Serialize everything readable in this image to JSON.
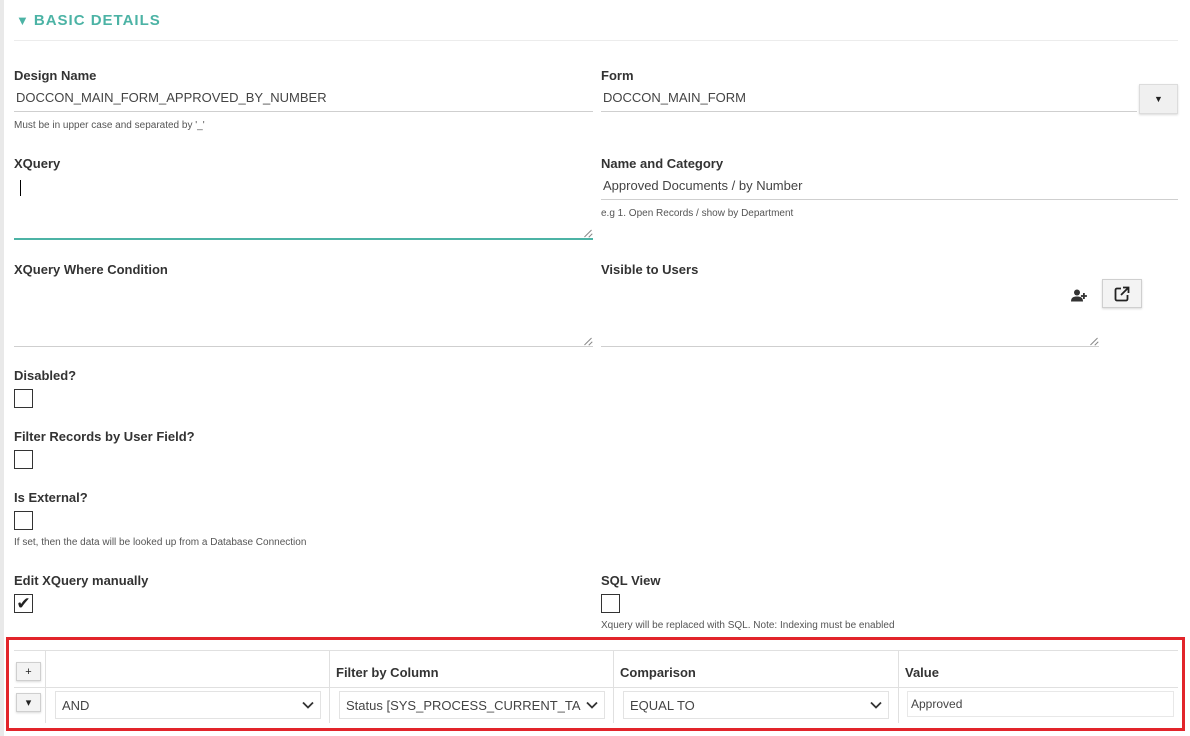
{
  "section": {
    "title": "BASIC DETAILS",
    "expanded_icon": "triangle-down-icon"
  },
  "fields": {
    "design_name": {
      "label": "Design Name",
      "value": "DOCCON_MAIN_FORM_APPROVED_BY_NUMBER",
      "hint": "Must be in upper case and separated by '_'"
    },
    "form": {
      "label": "Form",
      "value": "DOCCON_MAIN_FORM",
      "dropdown_icon": "caret-down-icon"
    },
    "xquery": {
      "label": "XQuery",
      "value": ""
    },
    "name_category": {
      "label": "Name and Category",
      "value": "Approved Documents / by Number",
      "hint": "e.g 1. Open Records / show by Department"
    },
    "xquery_where": {
      "label": "XQuery Where Condition",
      "value": ""
    },
    "visible_users": {
      "label": "Visible to Users",
      "value": ""
    },
    "disabled": {
      "label": "Disabled?",
      "checked": false
    },
    "filter_user": {
      "label": "Filter Records by User Field?",
      "checked": false
    },
    "is_external": {
      "label": "Is External?",
      "checked": false,
      "hint": "If set, then the data will be looked up from a Database Connection"
    },
    "edit_manually": {
      "label": "Edit XQuery manually",
      "checked": true,
      "check_glyph": "✔"
    },
    "sql_view": {
      "label": "SQL View",
      "checked": false,
      "hint": "Xquery will be replaced with SQL. Note: Indexing must be enabled"
    }
  },
  "filter_table": {
    "highlight_color": "#e2242a",
    "add_label": "+",
    "row_menu_glyph": "▾",
    "headers": {
      "filter_by_column": "Filter by Column",
      "comparison": "Comparison",
      "value": "Value"
    },
    "rows": [
      {
        "logic": "AND",
        "column": "Status [SYS_PROCESS_CURRENT_TA",
        "comparison": "EQUAL TO",
        "value": "Approved"
      }
    ]
  },
  "colors": {
    "accent": "#4cb3a5",
    "highlight": "#e2242a"
  }
}
